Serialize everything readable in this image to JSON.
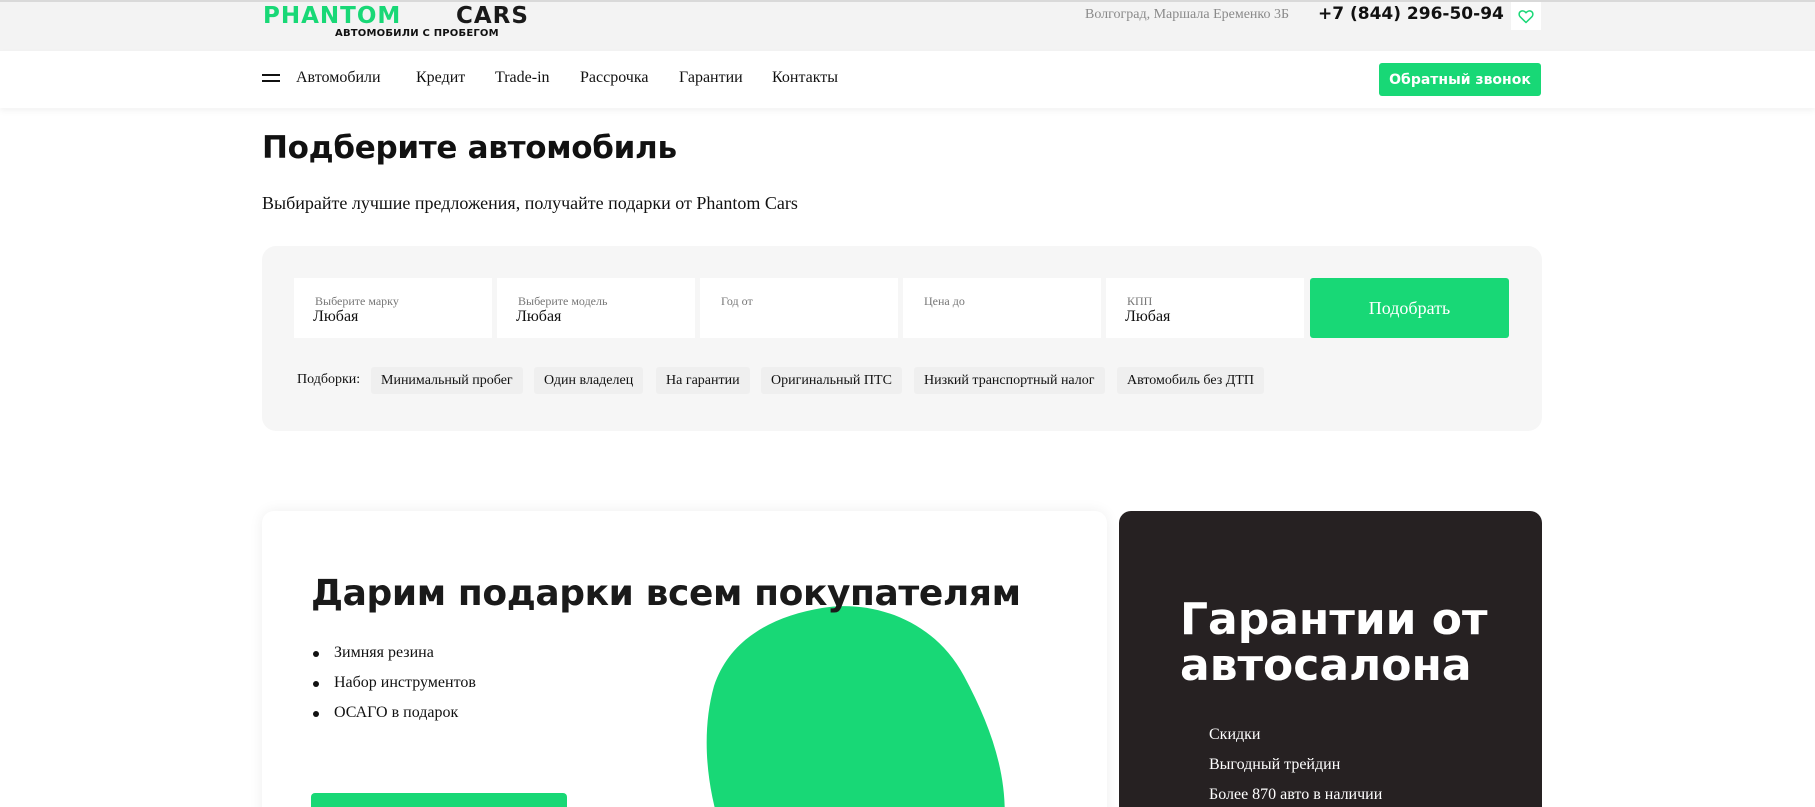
{
  "header": {
    "logo": {
      "word1": "PHANTOM",
      "word2": "CARS",
      "tagline": "АВТОМОБИЛИ С ПРОБЕГОМ"
    },
    "address": "Волгоград, Маршала Еременко 3Б",
    "phone": "+7 (844) 296-50-94",
    "favorites_icon": "heart-icon"
  },
  "nav": {
    "menu_icon": "hamburger-icon",
    "items": [
      {
        "label": "Автомобили"
      },
      {
        "label": "Кредит"
      },
      {
        "label": "Trade-in"
      },
      {
        "label": "Рассрочка"
      },
      {
        "label": "Гарантии"
      },
      {
        "label": "Контакты"
      }
    ],
    "callback_label": "Обратный звонок"
  },
  "hero": {
    "title": "Подберите автомобиль",
    "subtitle": "Выбирайте лучшие предложения, получайте подарки от Phantom Cars"
  },
  "filter": {
    "fields": [
      {
        "label": "Выберите марку",
        "value": "Любая"
      },
      {
        "label": "Выберите модель",
        "value": "Любая"
      },
      {
        "label": "Год от",
        "value": ""
      },
      {
        "label": "Цена до",
        "value": ""
      },
      {
        "label": "КПП",
        "value": "Любая"
      }
    ],
    "submit_label": "Подобрать",
    "picks_label": "Подборки:",
    "chips": [
      {
        "label": "Минимальный пробег"
      },
      {
        "label": "Один владелец"
      },
      {
        "label": "На гарантии"
      },
      {
        "label": "Оригинальный ПТС"
      },
      {
        "label": "Низкий транспортный налог"
      },
      {
        "label": "Автомобиль без ДТП"
      }
    ]
  },
  "promo": {
    "title": "Дарим подарки всем покупателям",
    "items": [
      "Зимняя резина",
      "Набор инструментов",
      "ОСАГО в подарок"
    ]
  },
  "warranty": {
    "title": "Гарантии от автосалона",
    "items": [
      "Скидки",
      "Выгодный трейдин",
      "Более 870 авто в наличии"
    ]
  },
  "colors": {
    "accent": "#18d876",
    "dark_card": "#262122",
    "panel_bg": "#f6f6f6",
    "topbar_bg": "#f3f3f3"
  }
}
